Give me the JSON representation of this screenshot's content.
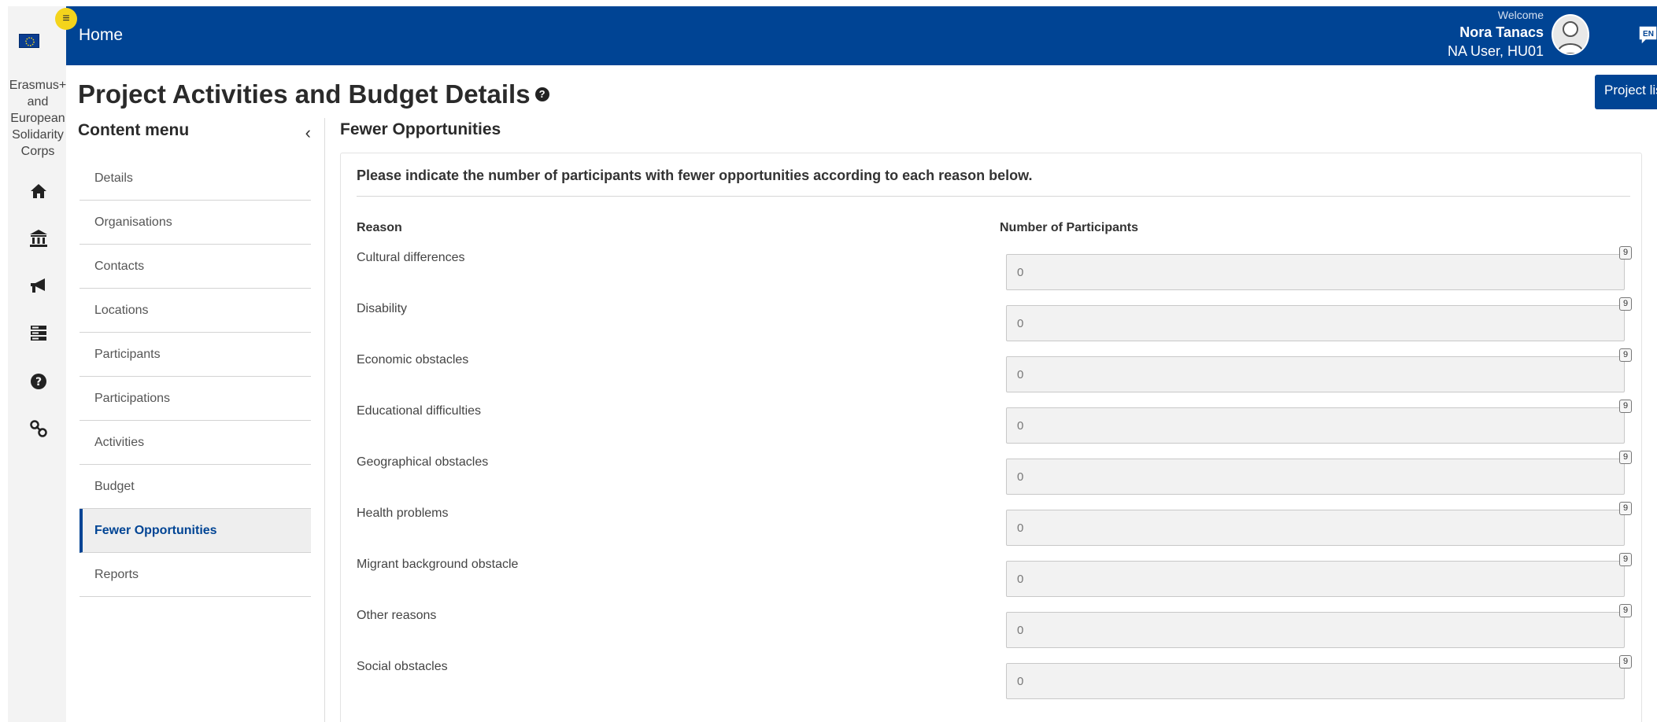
{
  "rail": {
    "brand_lines": [
      "Erasmus+",
      "and",
      "European",
      "Solidarity",
      "Corps"
    ],
    "menu_icon": "hamburger-icon",
    "icons": [
      "home-icon",
      "institution-icon",
      "megaphone-icon",
      "database-icon",
      "help-icon",
      "link-icon"
    ]
  },
  "header": {
    "home_label": "Home",
    "welcome": "Welcome",
    "user_name": "Nora Tanacs",
    "user_org": "NA User, HU01",
    "language": "EN",
    "accent": "#004494"
  },
  "page": {
    "title": "Project Activities and Budget Details",
    "project_list_label": "Project list"
  },
  "content_menu": {
    "title": "Content menu",
    "items": [
      {
        "label": "Details",
        "active": false
      },
      {
        "label": "Organisations",
        "active": false
      },
      {
        "label": "Contacts",
        "active": false
      },
      {
        "label": "Locations",
        "active": false
      },
      {
        "label": "Participants",
        "active": false
      },
      {
        "label": "Participations",
        "active": false
      },
      {
        "label": "Activities",
        "active": false
      },
      {
        "label": "Budget",
        "active": false
      },
      {
        "label": "Fewer Opportunities",
        "active": true
      },
      {
        "label": "Reports",
        "active": false
      }
    ]
  },
  "main": {
    "section_title": "Fewer Opportunities",
    "intro": "Please indicate the number of participants with fewer opportunities according to each reason below.",
    "col_reason": "Reason",
    "col_number": "Number of Participants",
    "rows": [
      {
        "reason": "Cultural differences",
        "value": "0",
        "badge": "9"
      },
      {
        "reason": "Disability",
        "value": "0",
        "badge": "9"
      },
      {
        "reason": "Economic obstacles",
        "value": "0",
        "badge": "9"
      },
      {
        "reason": "Educational difficulties",
        "value": "0",
        "badge": "9"
      },
      {
        "reason": "Geographical obstacles",
        "value": "0",
        "badge": "9"
      },
      {
        "reason": "Health problems",
        "value": "0",
        "badge": "9"
      },
      {
        "reason": "Migrant background obstacle",
        "value": "0",
        "badge": "9"
      },
      {
        "reason": "Other reasons",
        "value": "0",
        "badge": "9"
      },
      {
        "reason": "Social obstacles",
        "value": "0",
        "badge": "9"
      }
    ]
  }
}
